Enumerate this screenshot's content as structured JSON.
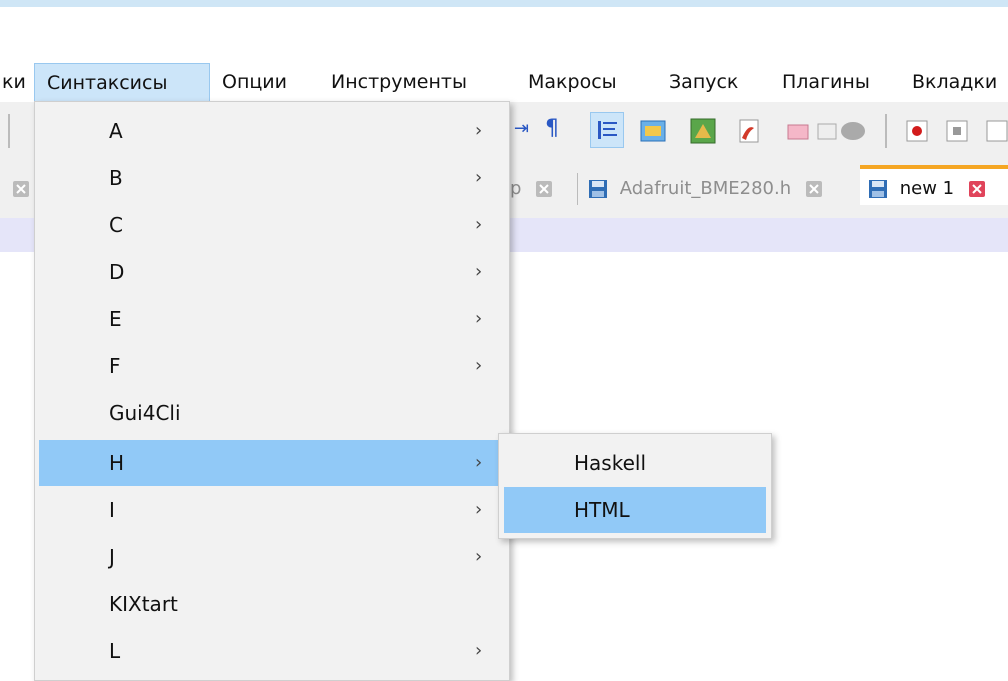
{
  "menubar": {
    "items": [
      {
        "label": "ки"
      },
      {
        "label": "Синтаксисы"
      },
      {
        "label": "Опции"
      },
      {
        "label": "Инструменты"
      },
      {
        "label": "Макросы"
      },
      {
        "label": "Запуск"
      },
      {
        "label": "Плагины"
      },
      {
        "label": "Вкладки"
      }
    ],
    "active_index": 1
  },
  "tabs": [
    {
      "label": "p",
      "state": "inactive"
    },
    {
      "label": "Adafruit_BME280.h",
      "state": "inactive"
    },
    {
      "label": "new 1",
      "state": "active"
    }
  ],
  "dropdown": {
    "items": [
      {
        "label": "A",
        "submenu": true
      },
      {
        "label": "B",
        "submenu": true
      },
      {
        "label": "C",
        "submenu": true
      },
      {
        "label": "D",
        "submenu": true
      },
      {
        "label": "E",
        "submenu": true
      },
      {
        "label": "F",
        "submenu": true
      },
      {
        "label": "Gui4Cli",
        "submenu": false
      },
      {
        "label": "H",
        "submenu": true,
        "highlighted": true
      },
      {
        "label": "I",
        "submenu": true
      },
      {
        "label": "J",
        "submenu": true
      },
      {
        "label": "KIXtart",
        "submenu": false
      },
      {
        "label": "L",
        "submenu": true
      }
    ],
    "arrow_glyph": "›"
  },
  "submenu": {
    "items": [
      {
        "label": "Haskell"
      },
      {
        "label": "HTML",
        "highlighted": true
      }
    ]
  },
  "colors": {
    "highlight": "#91c9f7",
    "menu_active": "#cce5f9",
    "tab_accent": "#f5a623",
    "lavender_bar": "#e5e5f9"
  }
}
